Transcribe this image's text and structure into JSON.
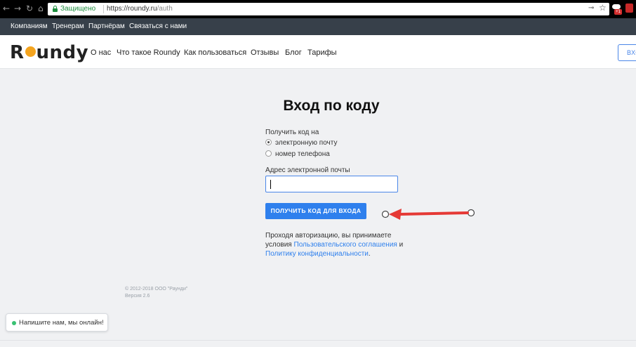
{
  "browser": {
    "secure_label": "Защищено",
    "url_host": "https://roundy.ru",
    "url_path": "/auth",
    "ext_badge": "+1"
  },
  "topnav": {
    "items": [
      "Компаниям",
      "Тренерам",
      "Партнёрам",
      "Связаться с нами"
    ]
  },
  "header": {
    "logo_prefix": "R",
    "logo_suffix": "undy",
    "nav": [
      "О нас",
      "Что такое Roundy",
      "Как пользоваться",
      "Отзывы",
      "Блог",
      "Тарифы"
    ],
    "login_label": "вход"
  },
  "auth": {
    "title": "Вход по коду",
    "get_code_label": "Получить код на",
    "options": [
      "электронную почту",
      "номер телефона"
    ],
    "selected_option": "электронную почту",
    "email_label": "Адрес электронной почты",
    "email_value": "",
    "submit_label": "ПОЛУЧИТЬ КОД ДЛЯ ВХОДА",
    "terms_prefix": "Проходя авторизацию, вы принимаете условия",
    "terms_link1": "Пользовательского соглашения",
    "terms_and": "и",
    "terms_link2": "Политику конфиденциальности",
    "terms_end": "."
  },
  "footer": {
    "copyright": "© 2012-2018 ООО \"Раунди\"",
    "version": "Версия 2.6"
  },
  "chat": {
    "text": "Напишите нам, мы онлайн!"
  },
  "colors": {
    "accent": "#2f80ed",
    "annotation_arrow": "#e53935"
  }
}
